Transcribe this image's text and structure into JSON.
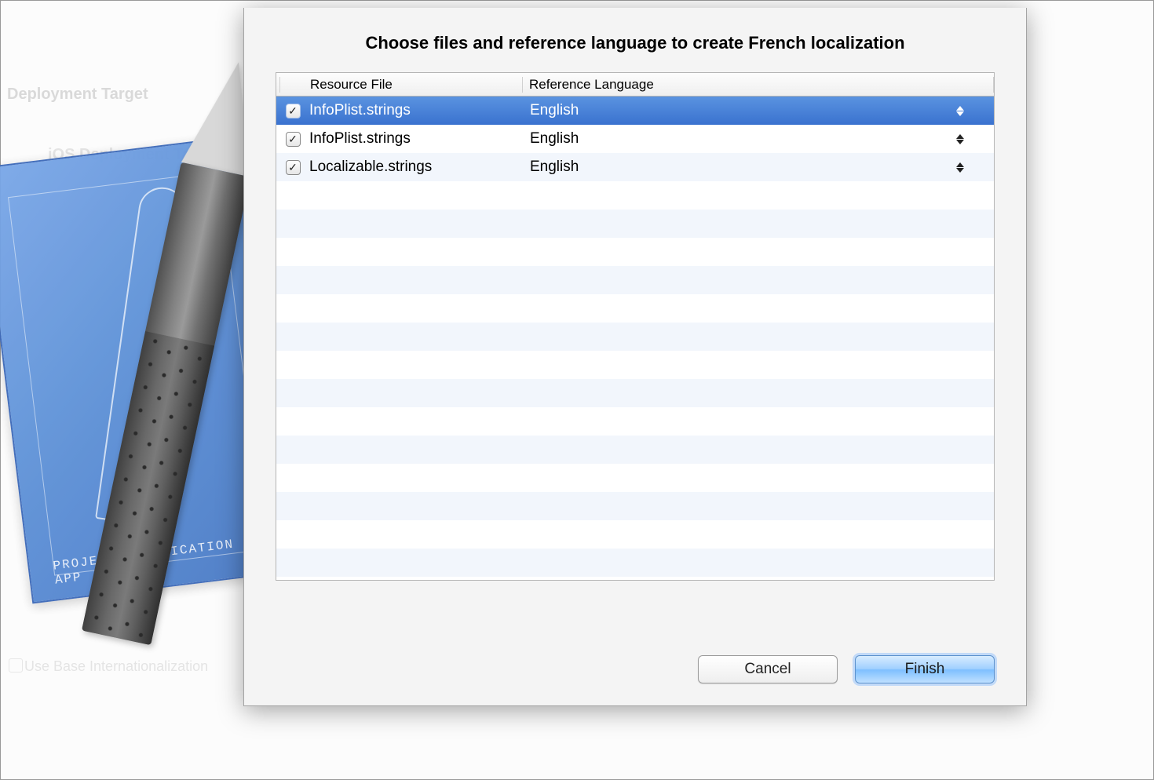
{
  "background": {
    "section_label": "Deployment Target",
    "sub_label": "iOS Deployment Target",
    "checkbox_label": "Use Base Internationalization",
    "blueprint_label": "PROJECT:  APPLICATION . APP"
  },
  "sheet": {
    "title": "Choose files and reference language to create French localization",
    "columns": {
      "file": "Resource File",
      "lang": "Reference Language"
    },
    "rows": [
      {
        "checked": true,
        "file": "InfoPlist.strings",
        "lang": "English",
        "selected": true
      },
      {
        "checked": true,
        "file": "InfoPlist.strings",
        "lang": "English",
        "selected": false
      },
      {
        "checked": true,
        "file": "Localizable.strings",
        "lang": "English",
        "selected": false
      }
    ],
    "buttons": {
      "cancel": "Cancel",
      "finish": "Finish"
    }
  }
}
